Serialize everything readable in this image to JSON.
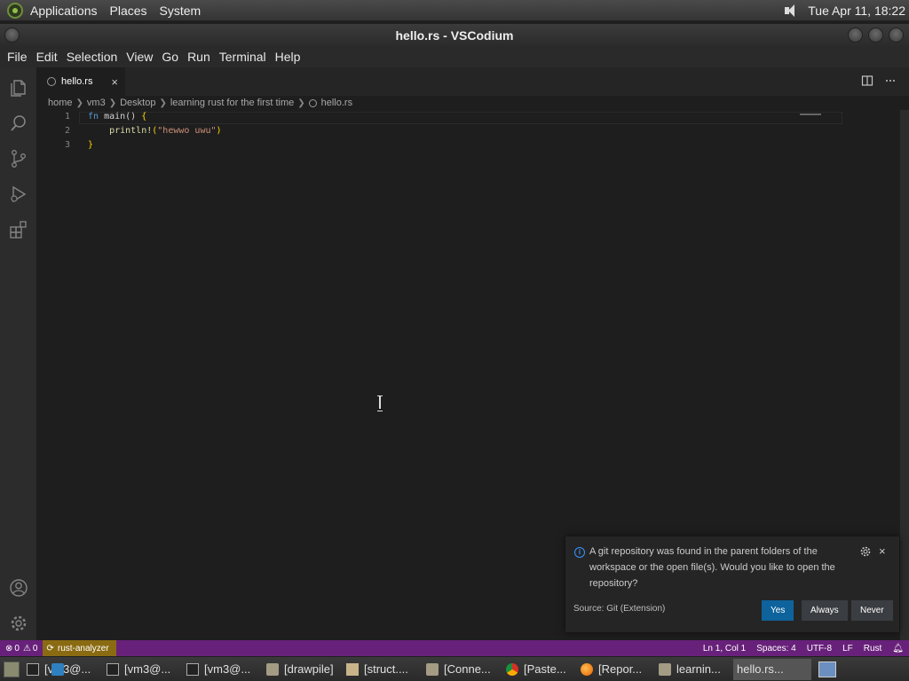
{
  "top_panel": {
    "menus": [
      "Applications",
      "Places",
      "System"
    ],
    "clock": "Tue Apr 11, 18:22"
  },
  "window": {
    "title": "hello.rs - VSCodium"
  },
  "menubar": [
    "File",
    "Edit",
    "Selection",
    "View",
    "Go",
    "Run",
    "Terminal",
    "Help"
  ],
  "tab": {
    "label": "hello.rs",
    "close": "×"
  },
  "breadcrumb": [
    "home",
    "vm3",
    "Desktop",
    "learning rust for the first time",
    "hello.rs"
  ],
  "editor": {
    "lines": [
      {
        "num": "1",
        "kw": "fn",
        "fn": " main",
        "rest": "() ",
        "brace": "{"
      },
      {
        "num": "2",
        "mac": "    println!",
        "open": "(",
        "str": "\"hewwo uwu\"",
        "close": ")"
      },
      {
        "num": "3",
        "brace": "}"
      }
    ]
  },
  "notification": {
    "message": "A git repository was found in the parent folders of the workspace or the open file(s). Would you like to open the repository?",
    "source": "Source: Git (Extension)",
    "buttons": {
      "yes": "Yes",
      "always": "Always",
      "never": "Never"
    },
    "close": "×"
  },
  "statusbar": {
    "errors": "0",
    "warnings": "0",
    "rust_analyzer": "rust-analyzer",
    "position": "Ln 1, Col 1",
    "spaces": "Spaces: 4",
    "encoding": "UTF-8",
    "eol": "LF",
    "language": "Rust"
  },
  "taskbar": [
    {
      "label": "[vm3@...",
      "icon": "terminal-icon"
    },
    {
      "label": "[vm3@...",
      "icon": "terminal-icon"
    },
    {
      "label": "[vm3@...",
      "icon": "terminal-icon"
    },
    {
      "label": "[drawpile]",
      "icon": "folder-icon"
    },
    {
      "label": "[struct....",
      "icon": "text-editor-icon"
    },
    {
      "label": "[Conne...",
      "icon": "folder-icon"
    },
    {
      "label": "[Paste...",
      "icon": "chrome-icon"
    },
    {
      "label": "[Repor...",
      "icon": "firefox-icon"
    },
    {
      "label": "learnin...",
      "icon": "folder-icon"
    },
    {
      "label": "hello.rs...",
      "icon": "vscodium-icon"
    }
  ],
  "colors": {
    "statusbar": "#68217a",
    "rust_analyzer_bg": "#8a6b12",
    "primary_button": "#0e639c",
    "info_icon": "#3794ff"
  }
}
